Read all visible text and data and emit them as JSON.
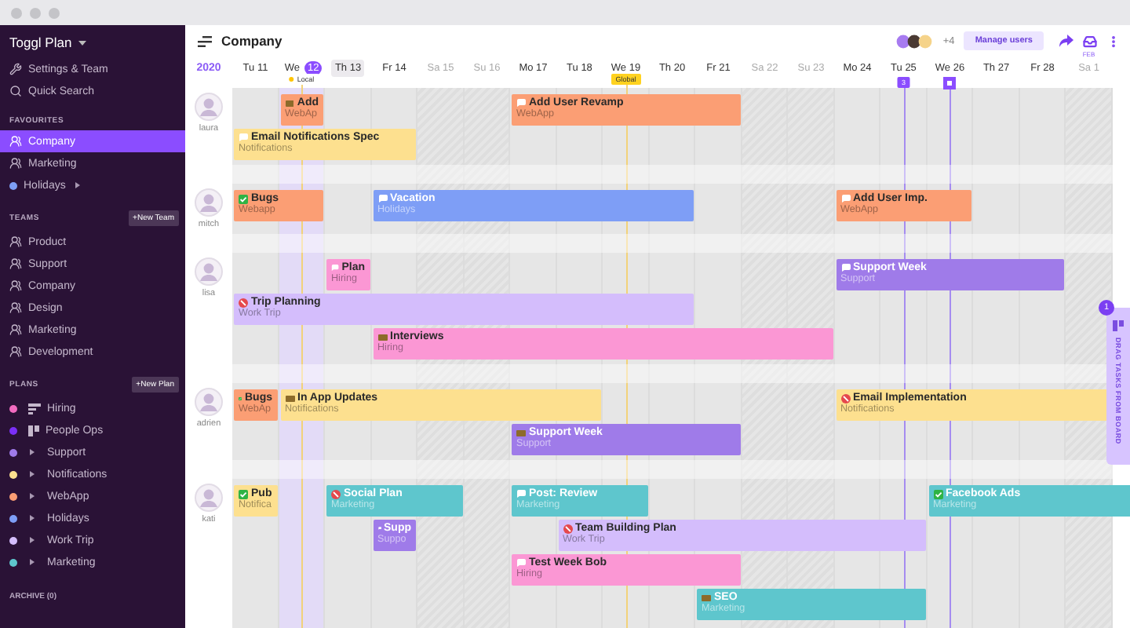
{
  "app": {
    "title": "Toggl Plan"
  },
  "sidebar": {
    "links": [
      {
        "label": "Settings & Team",
        "kind": "settings"
      },
      {
        "label": "Quick Search",
        "kind": "search"
      }
    ],
    "sections": [
      {
        "title": "FAVOURITES",
        "items": [
          {
            "label": "Company",
            "kind": "team",
            "selected": true
          },
          {
            "label": "Marketing",
            "kind": "team",
            "selected": false
          },
          {
            "label": "Holidays",
            "kind": "plan",
            "color": "#7e9ef6",
            "selected": false
          }
        ]
      },
      {
        "title": "TEAMS",
        "button": "+New Team",
        "items": [
          {
            "label": "Product",
            "kind": "team",
            "selected": false
          },
          {
            "label": "Support",
            "kind": "team",
            "selected": false
          },
          {
            "label": "Company",
            "kind": "team",
            "selected": false
          },
          {
            "label": "Design",
            "kind": "team",
            "selected": false
          },
          {
            "label": "Marketing",
            "kind": "team",
            "selected": false
          },
          {
            "label": "Development",
            "kind": "team",
            "selected": false
          }
        ]
      },
      {
        "title": "PLANS",
        "button": "+New Plan",
        "items": [
          {
            "label": "Hiring",
            "kind": "plan-list",
            "color": "#f26bc0",
            "selected": false
          },
          {
            "label": "People Ops",
            "kind": "plan-board",
            "color": "#7b2ff7",
            "selected": false
          },
          {
            "label": "Support",
            "kind": "plan-folder",
            "color": "#9f7be9",
            "selected": false
          },
          {
            "label": "Notifications",
            "kind": "plan-folder",
            "color": "#fde08f",
            "selected": false
          },
          {
            "label": "WebApp",
            "kind": "plan-folder",
            "color": "#fb9e74",
            "selected": false
          },
          {
            "label": "Holidays",
            "kind": "plan-folder",
            "color": "#7e9ef6",
            "selected": false
          },
          {
            "label": "Work Trip",
            "kind": "plan-folder",
            "color": "#d4bdfc",
            "selected": false
          },
          {
            "label": "Marketing",
            "kind": "plan-folder",
            "color": "#5ec6cd",
            "selected": false
          }
        ]
      }
    ],
    "archive": "ARCHIVE (0)"
  },
  "header": {
    "title": "Company",
    "extra_users": "+4",
    "manage_button": "Manage users"
  },
  "timeline": {
    "year": "2020",
    "days": [
      {
        "name": "Tu",
        "num": "11",
        "weekend": false,
        "today": false,
        "hover": false
      },
      {
        "name": "We",
        "num": "12",
        "weekend": false,
        "today": true,
        "hover": false
      },
      {
        "name": "Th",
        "num": "13",
        "weekend": false,
        "today": false,
        "hover": true
      },
      {
        "name": "Fr",
        "num": "14",
        "weekend": false,
        "today": false,
        "hover": false
      },
      {
        "name": "Sa",
        "num": "15",
        "weekend": true,
        "today": false,
        "hover": false
      },
      {
        "name": "Su",
        "num": "16",
        "weekend": true,
        "today": false,
        "hover": false
      },
      {
        "name": "Mo",
        "num": "17",
        "weekend": false,
        "today": false,
        "hover": false
      },
      {
        "name": "Tu",
        "num": "18",
        "weekend": false,
        "today": false,
        "hover": false
      },
      {
        "name": "We",
        "num": "19",
        "weekend": false,
        "today": false,
        "hover": false
      },
      {
        "name": "Th",
        "num": "20",
        "weekend": false,
        "today": false,
        "hover": false
      },
      {
        "name": "Fr",
        "num": "21",
        "weekend": false,
        "today": false,
        "hover": false
      },
      {
        "name": "Sa",
        "num": "22",
        "weekend": true,
        "today": false,
        "hover": false
      },
      {
        "name": "Su",
        "num": "23",
        "weekend": true,
        "today": false,
        "hover": false
      },
      {
        "name": "Mo",
        "num": "24",
        "weekend": false,
        "today": false,
        "hover": false
      },
      {
        "name": "Tu",
        "num": "25",
        "weekend": false,
        "today": false,
        "hover": false
      },
      {
        "name": "We",
        "num": "26",
        "weekend": false,
        "today": false,
        "hover": false
      },
      {
        "name": "Th",
        "num": "27",
        "weekend": false,
        "today": false,
        "hover": false
      },
      {
        "name": "Fr",
        "num": "28",
        "weekend": false,
        "today": false,
        "hover": false
      },
      {
        "name": "Sa",
        "num": "1",
        "month": "FEB",
        "weekend": true,
        "today": false,
        "hover": false
      }
    ],
    "markers": [
      {
        "kind": "local",
        "label": "Local"
      },
      {
        "kind": "global",
        "label": "Global"
      },
      {
        "kind": "milestone",
        "label": "3"
      },
      {
        "kind": "milestone-icon"
      }
    ]
  },
  "people": [
    {
      "name": "laura",
      "lanes": [
        [
          {
            "title": "Add",
            "plan": "WebAp",
            "kind": "tag",
            "color": "#fb9e74"
          },
          {
            "title": "Add User Revamp",
            "plan": "WebApp",
            "kind": "comment",
            "color": "#fb9e74"
          }
        ],
        [
          {
            "title": "Email Notifications Spec",
            "plan": "Notifications",
            "kind": "comment",
            "color": "#fde08f"
          }
        ]
      ]
    },
    {
      "name": "mitch",
      "lanes": [
        [
          {
            "title": "Bugs",
            "plan": "Webapp",
            "kind": "done",
            "color": "#fb9e74"
          },
          {
            "title": "Vacation",
            "plan": "Holidays",
            "kind": "comment",
            "color": "#7e9ef6"
          },
          {
            "title": "Add User Imp.",
            "plan": "WebApp",
            "kind": "comment",
            "color": "#fb9e74"
          }
        ]
      ]
    },
    {
      "name": "lisa",
      "lanes": [
        [
          {
            "title": "Plan",
            "plan": "Hiring",
            "kind": "comment",
            "color": "#fb97d4"
          },
          {
            "title": "Support Week",
            "plan": "Support",
            "kind": "comment",
            "color": "#9f7be9"
          }
        ],
        [
          {
            "title": "Trip Planning",
            "plan": "Work Trip",
            "kind": "blocked",
            "color": "#d4bdfc"
          }
        ],
        [
          {
            "title": "Interviews",
            "plan": "Hiring",
            "kind": "tag",
            "color": "#fb97d4"
          }
        ]
      ]
    },
    {
      "name": "adrien",
      "lanes": [
        [
          {
            "title": "Bugs",
            "plan": "WebAp",
            "kind": "done",
            "color": "#fb9e74"
          },
          {
            "title": "In App Updates",
            "plan": "Notifications",
            "kind": "tag",
            "color": "#fde08f"
          },
          {
            "title": "Email Implementation",
            "plan": "Notifications",
            "kind": "blocked",
            "color": "#fde08f"
          }
        ],
        [
          {
            "title": "Support Week",
            "plan": "Support",
            "kind": "tag",
            "color": "#9f7be9"
          }
        ]
      ]
    },
    {
      "name": "kati",
      "lanes": [
        [
          {
            "title": "Pub",
            "plan": "Notifica",
            "kind": "done",
            "color": "#fde08f"
          },
          {
            "title": "Social Plan",
            "plan": "Marketing",
            "kind": "blocked",
            "color": "#5ec6cd"
          },
          {
            "title": "Post: Review",
            "plan": "Marketing",
            "kind": "comment",
            "color": "#5ec6cd"
          },
          {
            "title": "Facebook Ads",
            "plan": "Marketing",
            "kind": "done",
            "color": "#5ec6cd"
          }
        ],
        [
          {
            "title": "Supp",
            "plan": "Suppo",
            "kind": "comment",
            "color": "#9f7be9"
          },
          {
            "title": "Team Building Plan",
            "plan": "Work Trip",
            "kind": "blocked",
            "color": "#d4bdfc"
          }
        ],
        [
          {
            "title": "Test Week Bob",
            "plan": "Hiring",
            "kind": "comment",
            "color": "#fb97d4"
          }
        ],
        [
          {
            "title": "SEO",
            "plan": "Marketing",
            "kind": "tag",
            "color": "#5ec6cd"
          }
        ]
      ]
    }
  ],
  "drag_panel": {
    "label": "DRAG TASKS FROM BOARD",
    "count": "1"
  }
}
